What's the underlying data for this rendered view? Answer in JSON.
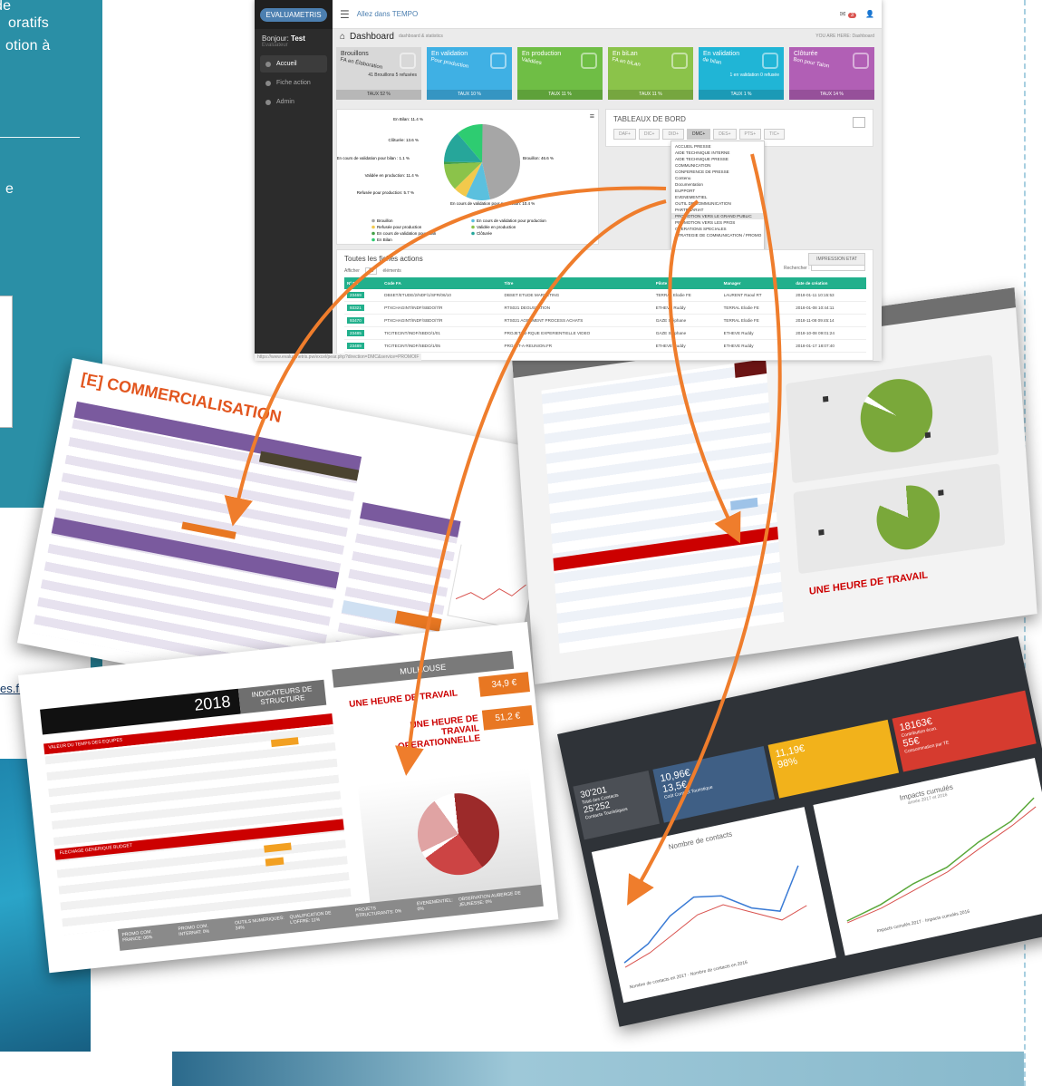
{
  "left_panel": {
    "lines": [
      "de",
      "oratifs",
      "otion à",
      "e"
    ],
    "link": "es.fr"
  },
  "dashboard": {
    "brand": "EVALUAMETRIS",
    "greeting_prefix": "Bonjour:",
    "greeting_name": "Test",
    "greeting_sub": "Evaluateur",
    "menu": [
      "Accueil",
      "Fiche action",
      "Admin"
    ],
    "topbar_link": "Allez dans TEMPO",
    "notif_count": "3",
    "page_title": "Dashboard",
    "page_sub": "dashboard & statistics",
    "breadcrumb": "YOU ARE HERE: Dashboard",
    "cards": [
      {
        "title": "Brouillons",
        "sub": "FA en Élaboration",
        "value": "46/88",
        "note": "41 Brouillons\n5 refusées",
        "foot": "TAUX 52 %",
        "color": "#d8d8d8",
        "textcolor": "#333"
      },
      {
        "title": "En validation",
        "sub": "Pour production",
        "value": "9/88",
        "note": "",
        "foot": "TAUX 10 %",
        "color": "#3fb0e4",
        "textcolor": "#fff"
      },
      {
        "title": "En production",
        "sub": "Validées",
        "value": "10/88",
        "note": "",
        "foot": "TAUX 11 %",
        "color": "#6fbe45",
        "textcolor": "#fff"
      },
      {
        "title": "En biLan",
        "sub": "FA en biLan",
        "value": "10/88",
        "note": "",
        "foot": "TAUX 11 %",
        "color": "#8bc34a",
        "textcolor": "#fff"
      },
      {
        "title": "En validation",
        "sub": "de bilan",
        "value": "1/88",
        "note": "1 en validation\n0 refusée",
        "foot": "TAUX 1 %",
        "color": "#20b5d6",
        "textcolor": "#fff"
      },
      {
        "title": "Clôturée",
        "sub": "Bon pour Talon",
        "value": "12/88",
        "note": "",
        "foot": "TAUX 14 %",
        "color": "#b15fb5",
        "textcolor": "#fff"
      }
    ],
    "pie_labels": [
      "En Bilan: 11.4 %",
      "Clôturée: 13.6 %",
      "En cours de validation pour bilan : 1.1 %",
      "Validée en production: 11.4 %",
      "Refusée pour production: 5.7 %",
      "En cours de validation pour production: 10.4 %",
      "Brouillon: 46.6 %"
    ],
    "legend": [
      "Brouillon",
      "En cours de validation pour production",
      "Refusée pour production",
      "Validée en production",
      "En cours de validation pour bilan",
      "Clôturée",
      "En Bilan"
    ],
    "tableaux_title": "TABLEAUX DE BORD",
    "tabs": [
      "DAF+",
      "DIC+",
      "DID+",
      "DMC+",
      "DES+",
      "PTS+",
      "TIC+"
    ],
    "dropdown": [
      "ACCUEIL PRESSE",
      "AIDE TECHNIQUE INTERNE",
      "AIDE TECHNIQUE PRESSE",
      "COMMUNICATION",
      "CONFERENCE DE PRESSE",
      "Contenu",
      "Documentation",
      "EUPPORT",
      "EVENEMENTIEL",
      "OUTIL DE COMMUNICATION",
      "PARTENARIAT",
      "PROMOTION VERS LE GRAND PUBLIC",
      "PROMOTION VERS LES PROS",
      "OPERATIONS SPECIALES",
      "STRATEGIE DE COMMUNICATION / PROMO"
    ],
    "list_title": "Toutes les fiches actions",
    "list_show": "Afficher",
    "list_count": "10",
    "list_elements": "éléments",
    "print_button": "IMPRESSION ETAT",
    "search_label": "Rechercher :",
    "columns": [
      "Nº FA",
      "Code FA",
      "Titre",
      "Pilote",
      "Manager",
      "date de création"
    ],
    "rows": [
      [
        "23469",
        "DBSET/ETUDE/2/NDF/1/SFR/06/10",
        "DBSET ETUDE MARKETING",
        "TERRAL Elodie FE",
        "LAURENT Raoul RT",
        "2018-01-11 10:15:53"
      ],
      [
        "93321",
        "PTXCHAGINT/INDF/SBDO/7/R",
        "RTS021 DEGUSTATION",
        "ETHEVE Ruddy",
        "TERRAL Elodie FE",
        "2018-01-08 10:44:11"
      ],
      [
        "93470",
        "PTXCHAGINT/INDF/SBDO/7/R",
        "RTS021 AGREMENT PROCESS ACHATS",
        "GAZE Stéphane",
        "TERRAL Elodie FE",
        "2018-11-08 09:45:14"
      ],
      [
        "23485",
        "TICITECINT/INDF/SBDO/1/01",
        "PROJET-12-RQUE EXPERIENTIELLE VIDEO",
        "GAZE Stéphane",
        "ETHEVE Ruddy",
        "2018-10-08 09:01:24"
      ],
      [
        "23489",
        "TICITECINT/INDF/SBDO/1/05",
        "PROJET-A-REUNION.FR",
        "ETHEVE Ruddy",
        "ETHEVE Ruddy",
        "2018-01-17 18:07:40"
      ]
    ],
    "url": "https://www.evaluametris.pw/excel/pear.php?direction=DMC&service=PROMOIF"
  },
  "snap_commercialisation": {
    "title": "[E] COMMERCIALISATION"
  },
  "snap_budget": {
    "hour": "UNE HEURE DE TRAVAIL"
  },
  "snap_indicateurs": {
    "year": "2018",
    "title": "INDICATEURS DE STRUCTURE",
    "city": "MULHOUSE",
    "hour1": "UNE HEURE DE TRAVAIL",
    "val1": "34,9 €",
    "hour2": "UNE HEURE DE TRAVAIL OPERATIONNELLE",
    "val2": "51,2 €",
    "bar1": "VALEUR DU TEMPS DES EQUIPES",
    "bar2": "FLECHAGE GENERIQUE BUDGET",
    "bottom_labels": [
      "PROMO COM. FRANCE: 06%",
      "PROMO COM. INTERNAT: 0%",
      "OUTILS NUMERIQUES: 34%",
      "QUALIFICATION DE L'OFFRE: 11%",
      "PROJETS STRUCTURANTS: 0%",
      "EVENEMENTIEL: 0%",
      "OBSERVATION AUBERGE DE JEUNESSE: 0%"
    ]
  },
  "snap_impacts": {
    "cardA_big": "30'201",
    "cardA_sub": "Total des Contacts",
    "cardA_big2": "25'252",
    "cardA_sub2": "Contacts Touristiques",
    "cardB_big": "10,96€",
    "cardB_big2": "13,5€",
    "cardB_sub": "Coût Contact Touristique",
    "cardC_big": "11,19€",
    "cardC_big2": "98%",
    "cardD_big": "18163€",
    "cardD_sub": "Contribution écon.",
    "cardD_big2": "55€",
    "cardD_sub2": "Consommation par TE",
    "chartA_title": "Nombre de contacts",
    "chartB_title": "Impacts cumulés",
    "chartB_sub": "année 2017 et 2016",
    "legendA": [
      "Nombre de contacts en 2017",
      "Nombre de contacts en 2016"
    ],
    "legendB": [
      "Impacts cumulés 2017",
      "Impacts cumulés 2016"
    ]
  }
}
